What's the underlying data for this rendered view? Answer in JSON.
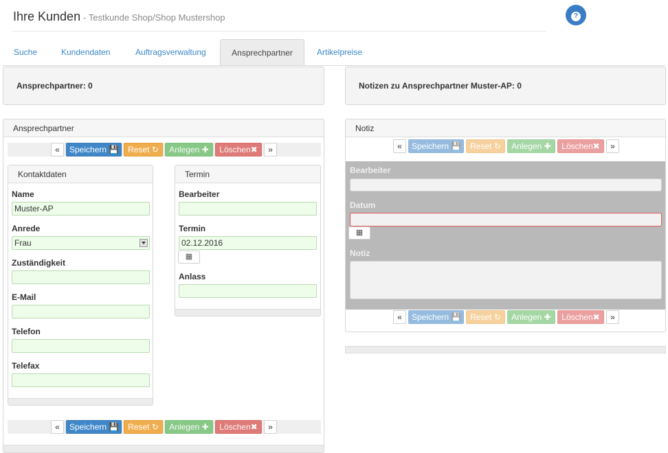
{
  "header": {
    "title": "Ihre Kunden",
    "subtitle": "- Testkunde Shop/Shop Mustershop",
    "help_icon": "question-circle-icon"
  },
  "tabs": [
    {
      "label": "Suche",
      "active": false
    },
    {
      "label": "Kundendaten",
      "active": false
    },
    {
      "label": "Auftragsverwaltung",
      "active": false
    },
    {
      "label": "Ansprechpartner",
      "active": true
    },
    {
      "label": "Artikelpreise",
      "active": false
    }
  ],
  "summary": {
    "left": "Ansprechpartner: 0",
    "right": "Notizen zu Ansprechpartner Muster-AP: 0"
  },
  "contact_panel": {
    "title": "Ansprechpartner",
    "buttons": {
      "prev": "«",
      "next": "»",
      "save": "Speichern",
      "reset": "Reset",
      "add": "Anlegen",
      "delete": "Löschen"
    },
    "kontakt": {
      "title": "Kontaktdaten",
      "name_label": "Name",
      "name_value": "Muster-AP",
      "anrede_label": "Anrede",
      "anrede_value": "Frau",
      "zust_label": "Zuständigkeit",
      "zust_value": "",
      "email_label": "E-Mail",
      "email_value": "",
      "telefon_label": "Telefon",
      "telefon_value": "",
      "telefax_label": "Telefax",
      "telefax_value": ""
    },
    "termin": {
      "title": "Termin",
      "bearbeiter_label": "Bearbeiter",
      "bearbeiter_value": "",
      "termin_label": "Termin",
      "termin_value": "02.12.2016",
      "anlass_label": "Anlass",
      "anlass_value": ""
    }
  },
  "notiz_panel": {
    "title": "Notiz",
    "bearbeiter_label": "Bearbeiter",
    "datum_label": "Datum",
    "notiz_label": "Notiz"
  },
  "colors": {
    "primary": "#3f87c8",
    "warning": "#f0ad4e",
    "success": "#5cb85c",
    "danger": "#d9534f",
    "input_bg": "#eefdea"
  }
}
